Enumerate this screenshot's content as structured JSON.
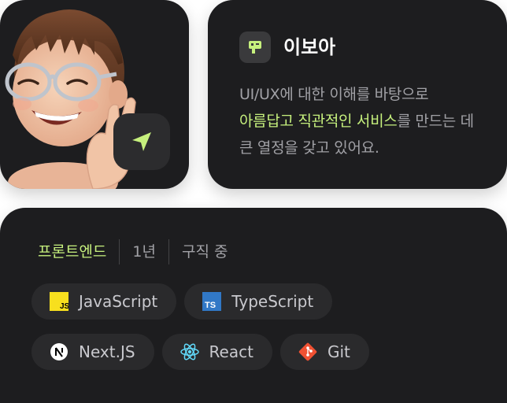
{
  "profile": {
    "name": "이보아",
    "bio_before": "UI/UX에 대한 이해를 바탕으로",
    "bio_highlight": "아름답고 직관적인 서비스",
    "bio_after": "를 만드는 데 큰 열정을 갖고 있어요.",
    "accent_color": "#c6f07d"
  },
  "avatar": {
    "icon": "memoji-avatar",
    "action_icon": "send-icon"
  },
  "meta": {
    "role": "프론트엔드",
    "experience": "1년",
    "status": "구직 중"
  },
  "skills": [
    {
      "label": "JavaScript",
      "icon": "javascript-icon"
    },
    {
      "label": "TypeScript",
      "icon": "typescript-icon"
    },
    {
      "label": "Next.JS",
      "icon": "nextjs-icon"
    },
    {
      "label": "React",
      "icon": "react-icon"
    },
    {
      "label": "Git",
      "icon": "git-icon"
    }
  ]
}
